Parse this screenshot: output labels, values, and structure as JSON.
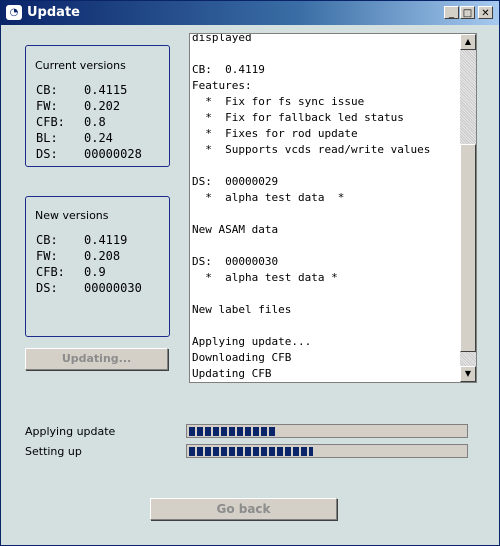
{
  "window": {
    "title": "Update",
    "icon": "app-icon"
  },
  "title_buttons": {
    "minimize": "_",
    "maximize": "□",
    "close": "✕"
  },
  "current_versions": {
    "title": "Current versions",
    "rows": [
      {
        "key": "CB:",
        "value": "0.4115"
      },
      {
        "key": "FW:",
        "value": "0.202"
      },
      {
        "key": "CFB:",
        "value": "0.8"
      },
      {
        "key": "BL:",
        "value": "0.24"
      },
      {
        "key": "DS:",
        "value": "00000028"
      }
    ]
  },
  "new_versions": {
    "title": "New versions",
    "rows": [
      {
        "key": "CB:",
        "value": "0.4119"
      },
      {
        "key": "FW:",
        "value": "0.208"
      },
      {
        "key": "CFB:",
        "value": "0.9"
      },
      {
        "key": "DS:",
        "value": "00000030"
      }
    ]
  },
  "updating_button": "Updating...",
  "log_lines": [
    "displayed",
    "",
    "CB:  0.4119",
    "Features:",
    "  *  Fix for fs sync issue",
    "  *  Fix for fallback led status",
    "  *  Fixes for rod update",
    "  *  Supports vcds read/write values",
    "",
    "DS:  00000029",
    "  *  alpha test data  *",
    "",
    "New ASAM data",
    "",
    "DS:  00000030",
    "  *  alpha test data *",
    "",
    "New label files",
    "",
    "Applying update...",
    "Downloading CFB",
    "Updating CFB"
  ],
  "progress": {
    "applying": {
      "label": "Applying update",
      "fraction": 0.31
    },
    "setting_up": {
      "label": "Setting up",
      "fraction": 0.45
    }
  },
  "go_back_button": "Go back"
}
